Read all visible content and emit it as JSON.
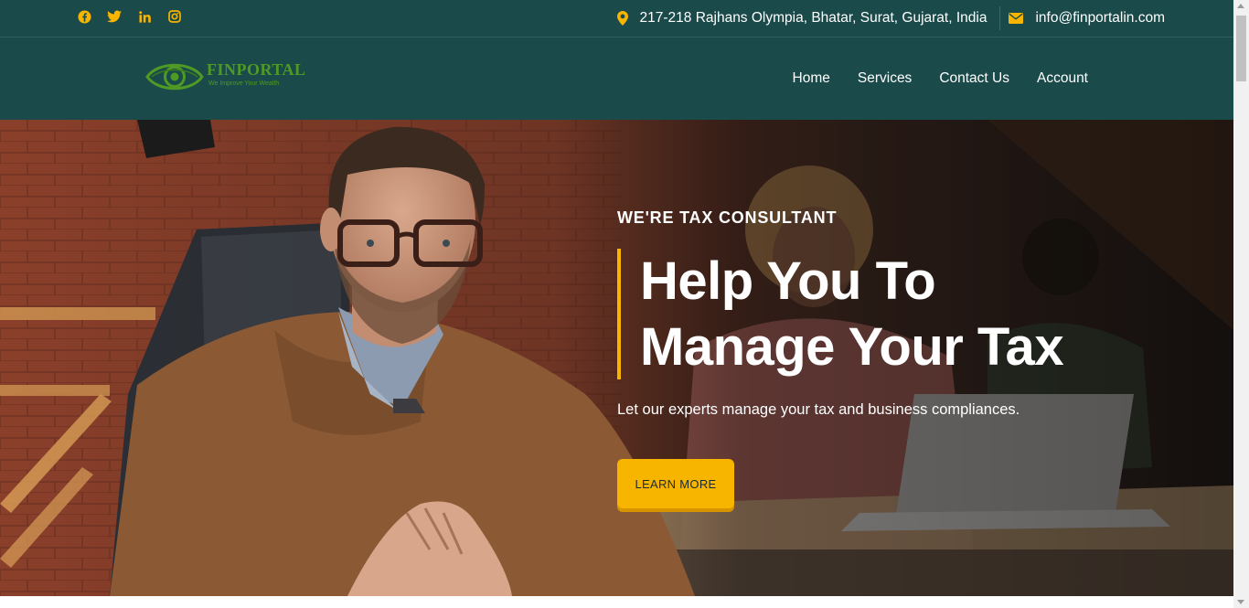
{
  "colors": {
    "brand_dark": "#1b4a4a",
    "accent": "#f7b500",
    "logo_green": "#4e9a25"
  },
  "topbar": {
    "social_icons": [
      "facebook-icon",
      "twitter-icon",
      "linkedin-icon",
      "instagram-icon"
    ],
    "address": "217-218 Rajhans Olympia, Bhatar, Surat, Gujarat, India",
    "email": "info@finportalin.com",
    "address_icon": "map-pin-icon",
    "email_icon": "envelope-icon"
  },
  "logo": {
    "name": "FINPORTAL",
    "tagline": "We Improve Your Wealth"
  },
  "nav": {
    "items": [
      "Home",
      "Services",
      "Contact Us",
      "Account"
    ]
  },
  "hero": {
    "eyebrow": "WE'RE TAX CONSULTANT",
    "headline_line1": "Help You To",
    "headline_line2": "Manage Your Tax",
    "subtext": "Let our experts manage your tax and business compliances.",
    "cta_label": "LEARN MORE"
  }
}
